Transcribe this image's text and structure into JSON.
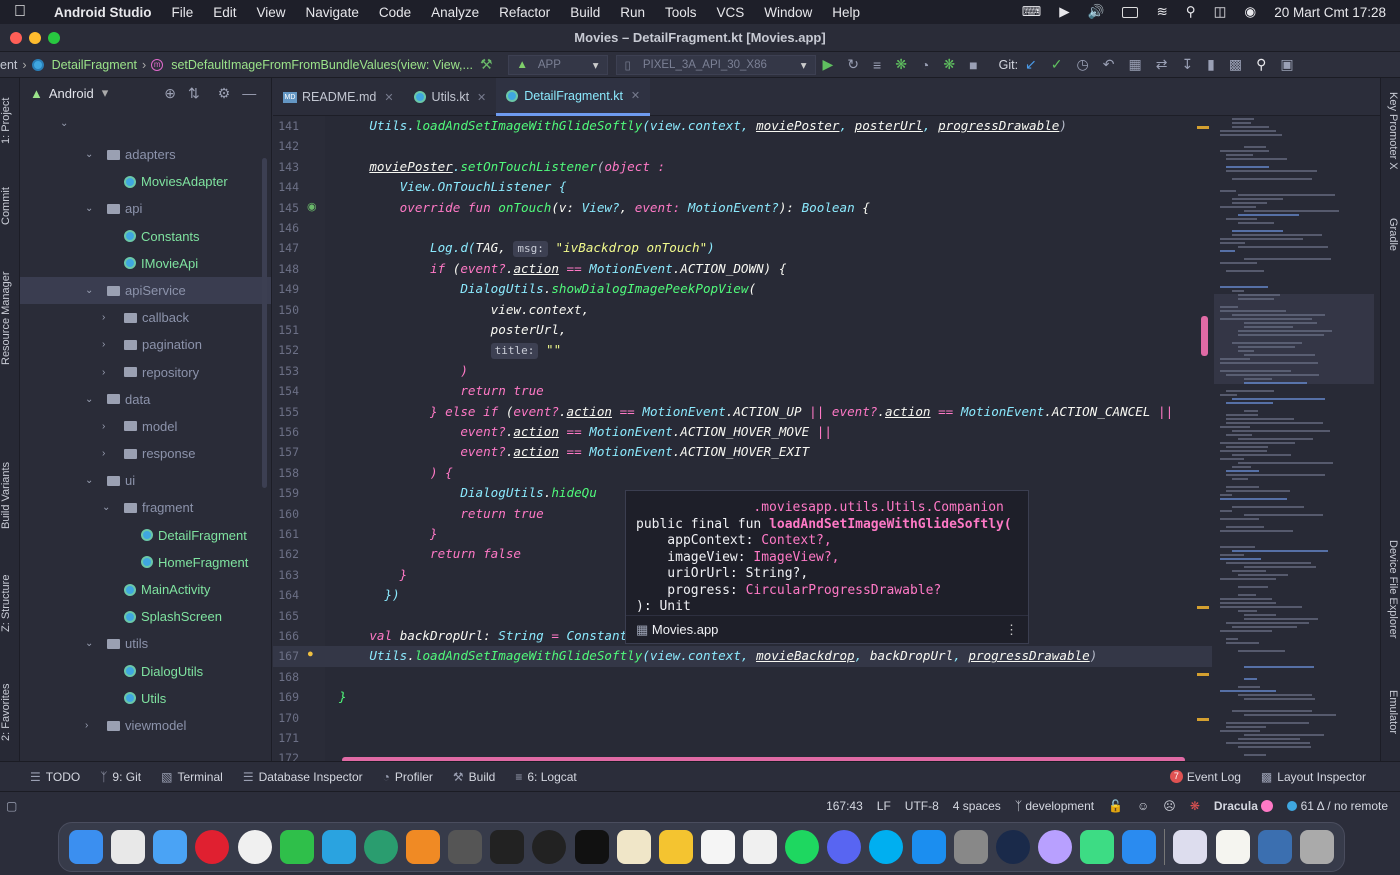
{
  "menubar": {
    "app": "Android Studio",
    "items": [
      "File",
      "Edit",
      "View",
      "Navigate",
      "Code",
      "Analyze",
      "Refactor",
      "Build",
      "Run",
      "Tools",
      "VCS",
      "Window",
      "Help"
    ],
    "datetime": "20 Mart Cmt  17:28"
  },
  "window": {
    "title": "Movies – DetailFragment.kt [Movies.app]"
  },
  "navbar": {
    "crumb_prefix": "ent",
    "crumb_class": "DetailFragment",
    "crumb_method": "setDefaultImageFromFromBundleValues(view: View,...",
    "run_config": "APP",
    "device": "PIXEL_3A_API_30_X86",
    "git_label": "Git:"
  },
  "left_tools": [
    "1: Project",
    "Commit",
    "Resource Manager",
    "Build Variants",
    "Z: Structure",
    "2: Favorites"
  ],
  "right_tools": [
    "Key Promoter X",
    "Gradle",
    "Device File Explorer",
    "Emulator"
  ],
  "project": {
    "view": "Android",
    "tree": [
      {
        "label": "adapters",
        "type": "folder",
        "depth": 1,
        "expanded": true
      },
      {
        "label": "MoviesAdapter",
        "type": "class",
        "depth": 2
      },
      {
        "label": "api",
        "type": "folder",
        "depth": 1,
        "expanded": true
      },
      {
        "label": "Constants",
        "type": "class",
        "depth": 2
      },
      {
        "label": "IMovieApi",
        "type": "class",
        "depth": 2
      },
      {
        "label": "apiService",
        "type": "folder",
        "depth": 1,
        "expanded": true,
        "selected": true
      },
      {
        "label": "callback",
        "type": "folder",
        "depth": 2,
        "expanded": false
      },
      {
        "label": "pagination",
        "type": "folder",
        "depth": 2,
        "expanded": false
      },
      {
        "label": "repository",
        "type": "folder",
        "depth": 2,
        "expanded": false
      },
      {
        "label": "data",
        "type": "folder",
        "depth": 1,
        "expanded": true
      },
      {
        "label": "model",
        "type": "folder",
        "depth": 2,
        "expanded": false
      },
      {
        "label": "response",
        "type": "folder",
        "depth": 2,
        "expanded": false
      },
      {
        "label": "ui",
        "type": "folder",
        "depth": 1,
        "expanded": true
      },
      {
        "label": "fragment",
        "type": "folder",
        "depth": 2,
        "expanded": true
      },
      {
        "label": "DetailFragment",
        "type": "class",
        "depth": 3
      },
      {
        "label": "HomeFragment",
        "type": "class",
        "depth": 3
      },
      {
        "label": "MainActivity",
        "type": "class",
        "depth": 2
      },
      {
        "label": "SplashScreen",
        "type": "class",
        "depth": 2
      },
      {
        "label": "utils",
        "type": "folder",
        "depth": 1,
        "expanded": true
      },
      {
        "label": "DialogUtils",
        "type": "class",
        "depth": 2
      },
      {
        "label": "Utils",
        "type": "class",
        "depth": 2
      },
      {
        "label": "viewmodel",
        "type": "folder",
        "depth": 1,
        "expanded": false
      }
    ]
  },
  "tabs": [
    {
      "label": "README.md",
      "icon": "markdown"
    },
    {
      "label": "Utils.kt",
      "icon": "kotlin"
    },
    {
      "label": "DetailFragment.kt",
      "icon": "kotlin",
      "active": true
    }
  ],
  "editor": {
    "current_line": 167,
    "lines": [
      {
        "n": 141,
        "segs": [
          [
            "    ",
            "w"
          ],
          [
            "Utils",
            ""
          ],
          [
            ".",
            ""
          ],
          [
            "loadAndSetImageWithGlideSoftly",
            "f"
          ],
          [
            "(view.context, ",
            "t"
          ],
          [
            "moviePoster",
            "w"
          ],
          [
            ", ",
            "t"
          ],
          [
            "posterUrl",
            "w"
          ],
          [
            ", ",
            "t"
          ],
          [
            "progressDrawable",
            "w"
          ],
          [
            ")",
            "p"
          ]
        ]
      },
      {
        "n": 142,
        "segs": []
      },
      {
        "n": 143,
        "segs": [
          [
            "    ",
            "w"
          ],
          [
            "moviePoster",
            "w"
          ],
          [
            ".",
            ""
          ],
          [
            "setOnTouchListener",
            "f"
          ],
          [
            "(",
            "p"
          ],
          [
            "object",
            "k"
          ],
          [
            " :",
            "k"
          ]
        ]
      },
      {
        "n": 144,
        "segs": [
          [
            "        ",
            "w"
          ],
          [
            "View.OnTouchListener {",
            "t"
          ]
        ]
      },
      {
        "n": 145,
        "segs": [
          [
            "        ",
            "w"
          ],
          [
            "override fun ",
            "k"
          ],
          [
            "onTouch",
            "f"
          ],
          [
            "(v: ",
            "w"
          ],
          [
            "View?",
            "t"
          ],
          [
            ", ",
            "w"
          ],
          [
            "event: ",
            "k"
          ],
          [
            "MotionEvent?",
            "t"
          ],
          [
            "): ",
            "w"
          ],
          [
            "Boolean",
            "t"
          ],
          [
            " {",
            "w"
          ]
        ]
      },
      {
        "n": 146,
        "segs": []
      },
      {
        "n": 147,
        "segs": [
          [
            "            ",
            "w"
          ],
          [
            "Log.d(",
            "t"
          ],
          [
            "TAG, ",
            "w"
          ],
          [
            "msg:",
            "ph"
          ],
          [
            " \"ivBackdrop onTouch\"",
            "s"
          ],
          [
            ")",
            "t"
          ]
        ]
      },
      {
        "n": 148,
        "segs": [
          [
            "            ",
            "w"
          ],
          [
            "if ",
            "k"
          ],
          [
            "(",
            "w"
          ],
          [
            "event?",
            "k"
          ],
          [
            ".",
            "w"
          ],
          [
            "action",
            "w"
          ],
          [
            " == ",
            "k"
          ],
          [
            "MotionEvent",
            "t"
          ],
          [
            ".ACTION_DOWN) {",
            "w"
          ]
        ]
      },
      {
        "n": 149,
        "segs": [
          [
            "                ",
            "w"
          ],
          [
            "DialogUtils",
            "t"
          ],
          [
            ".",
            "w"
          ],
          [
            "showDialogImagePeekPopView",
            "f"
          ],
          [
            "(",
            "w"
          ]
        ]
      },
      {
        "n": 150,
        "segs": [
          [
            "                    ",
            "w"
          ],
          [
            "view.context,",
            "w"
          ]
        ]
      },
      {
        "n": 151,
        "segs": [
          [
            "                    ",
            "w"
          ],
          [
            "posterUrl,",
            "w"
          ]
        ]
      },
      {
        "n": 152,
        "segs": [
          [
            "                    ",
            "w"
          ],
          [
            "title:",
            "ph"
          ],
          [
            " \"\"",
            "s"
          ]
        ]
      },
      {
        "n": 153,
        "segs": [
          [
            "                ",
            "w"
          ],
          [
            ")",
            "k"
          ]
        ]
      },
      {
        "n": 154,
        "segs": [
          [
            "                ",
            "w"
          ],
          [
            "return true",
            "k"
          ]
        ]
      },
      {
        "n": 155,
        "segs": [
          [
            "            ",
            "w"
          ],
          [
            "} else if ",
            "k"
          ],
          [
            "(",
            "w"
          ],
          [
            "event?",
            "k"
          ],
          [
            ".",
            "w"
          ],
          [
            "action",
            "w"
          ],
          [
            " == ",
            "k"
          ],
          [
            "MotionEvent",
            "t"
          ],
          [
            ".ACTION_UP ",
            "w"
          ],
          [
            "|| ",
            "k"
          ],
          [
            "event?",
            "k"
          ],
          [
            ".",
            "w"
          ],
          [
            "action",
            "w"
          ],
          [
            " == ",
            "k"
          ],
          [
            "MotionEvent",
            "t"
          ],
          [
            ".ACTION_CANCEL ",
            "w"
          ],
          [
            "||",
            "k"
          ]
        ]
      },
      {
        "n": 156,
        "segs": [
          [
            "                ",
            "w"
          ],
          [
            "event?",
            "k"
          ],
          [
            ".",
            "w"
          ],
          [
            "action",
            "w"
          ],
          [
            " == ",
            "k"
          ],
          [
            "MotionEvent",
            "t"
          ],
          [
            ".ACTION_HOVER_MOVE ",
            "w"
          ],
          [
            "||",
            "k"
          ]
        ]
      },
      {
        "n": 157,
        "segs": [
          [
            "                ",
            "w"
          ],
          [
            "event?",
            "k"
          ],
          [
            ".",
            "w"
          ],
          [
            "action",
            "w"
          ],
          [
            " == ",
            "k"
          ],
          [
            "MotionEvent",
            "t"
          ],
          [
            ".ACTION_HOVER_EXIT",
            "w"
          ]
        ]
      },
      {
        "n": 158,
        "segs": [
          [
            "            ",
            "w"
          ],
          [
            ") {",
            "k"
          ]
        ]
      },
      {
        "n": 159,
        "segs": [
          [
            "                ",
            "w"
          ],
          [
            "DialogUtils",
            "t"
          ],
          [
            ".",
            "w"
          ],
          [
            "hideQu",
            "f"
          ]
        ]
      },
      {
        "n": 160,
        "segs": [
          [
            "                ",
            "w"
          ],
          [
            "return true",
            "k"
          ]
        ]
      },
      {
        "n": 161,
        "segs": [
          [
            "            ",
            "w"
          ],
          [
            "}",
            "k"
          ]
        ]
      },
      {
        "n": 162,
        "segs": [
          [
            "            ",
            "w"
          ],
          [
            "return false",
            "k"
          ]
        ]
      },
      {
        "n": 163,
        "segs": [
          [
            "        ",
            "w"
          ],
          [
            "}",
            "k"
          ]
        ]
      },
      {
        "n": 164,
        "segs": [
          [
            "      ",
            "w"
          ],
          [
            "})",
            "t"
          ]
        ]
      },
      {
        "n": 165,
        "segs": []
      },
      {
        "n": 166,
        "segs": [
          [
            "    ",
            "w"
          ],
          [
            "val ",
            "k"
          ],
          [
            "backDropUrl: ",
            "w"
          ],
          [
            "String",
            "t"
          ],
          [
            " = ",
            "k"
          ],
          [
            "Constant",
            "t"
          ]
        ]
      },
      {
        "n": 167,
        "segs": [
          [
            "    ",
            "w"
          ],
          [
            "Utils",
            "t"
          ],
          [
            ".",
            "w"
          ],
          [
            "loadAndSetImageWithGlideSoftly",
            "f"
          ],
          [
            "(view.context, ",
            "t"
          ],
          [
            "movieBackdrop",
            "w"
          ],
          [
            ", ",
            "t"
          ],
          [
            "backDropUrl",
            "w"
          ],
          [
            ", ",
            "t"
          ],
          [
            "progressDrawable",
            "w"
          ],
          [
            ")",
            "p"
          ]
        ]
      },
      {
        "n": 168,
        "segs": []
      },
      {
        "n": 169,
        "segs": [
          [
            "}",
            "f"
          ]
        ]
      },
      {
        "n": 170,
        "segs": []
      },
      {
        "n": 171,
        "segs": []
      },
      {
        "n": 172,
        "segs": []
      }
    ]
  },
  "popup": {
    "lines": [
      [
        "               .moviesapp.utils.Utils.Companion",
        "k"
      ],
      [
        "public final fun ",
        "w",
        "loadAndSetImageWithGlideSoftly(",
        "f"
      ],
      [
        "    appContext: ",
        "w",
        "Context?,",
        "k"
      ],
      [
        "    imageView: ",
        "w",
        "ImageView?,",
        "k"
      ],
      [
        "    uriOrUrl: String?,",
        "w",
        ""
      ],
      [
        "    progress: ",
        "w",
        "CircularProgressDrawable?",
        "k"
      ],
      [
        "): Unit",
        "w",
        ""
      ]
    ],
    "module": "Movies.app"
  },
  "tool_windows": {
    "left": [
      "TODO",
      "9: Git",
      "Terminal",
      "Database Inspector",
      "Profiler",
      "Build",
      "6: Logcat"
    ],
    "right": [
      "Event Log",
      "Layout Inspector"
    ],
    "event_count": "7"
  },
  "status": {
    "position": "167:43",
    "line_sep": "LF",
    "encoding": "UTF-8",
    "indent": "4 spaces",
    "branch": "development",
    "theme": "Dracula",
    "git": "61 Δ / no remote"
  },
  "colors": {
    "keyword": "#ff79c6",
    "function": "#50fa7b",
    "type": "#8be9fd",
    "string": "#f1fa8c",
    "accent": "#e06aa5"
  },
  "dock": [
    "finder",
    "launchpad",
    "safari",
    "opera",
    "chrome",
    "whatsapp",
    "telegram",
    "atom",
    "sublime",
    "xcode-instruments",
    "terminal-app",
    "github",
    "terminal",
    "textedit",
    "keep",
    "photos",
    "pinwheel",
    "spotify",
    "discord",
    "skype",
    "app-store",
    "system-preferences",
    "steam",
    "lightbulb",
    "android-studio",
    "xcode",
    "sep",
    "preview",
    "notes",
    "finder-window",
    "trash"
  ]
}
